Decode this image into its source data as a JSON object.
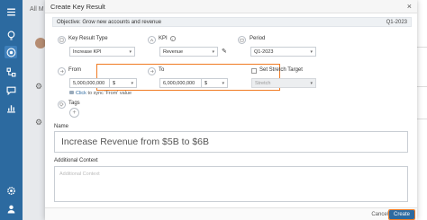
{
  "background": {
    "title": "All M"
  },
  "modal": {
    "title": "Create Key Result",
    "close_symbol": "×"
  },
  "objective": {
    "text": "Objective: Grow new accounts and revenue",
    "period": "Q1-2023"
  },
  "fields": {
    "key_result_type": {
      "label": "Key Result Type",
      "value": "Increase KPI"
    },
    "kpi": {
      "label": "KPI",
      "value": "Revenue"
    },
    "period": {
      "label": "Period",
      "value": "Q1-2023"
    },
    "from": {
      "label": "From",
      "value": "5,000,000,000",
      "unit": "$"
    },
    "to": {
      "label": "To",
      "value": "6,000,000,000",
      "unit": "$"
    },
    "stretch": {
      "label": "Set Stretch Target",
      "value": "Stretch"
    },
    "sync": {
      "link": "Click",
      "text": " to sync 'From' value"
    },
    "tags": {
      "label": "Tags",
      "add": "+"
    },
    "name": {
      "label": "Name",
      "value": "Increase Revenue from $5B to $6B"
    },
    "context": {
      "label": "Additional Context",
      "placeholder": "Additional Context"
    }
  },
  "footer": {
    "cancel": "Cancel",
    "create": "Create"
  },
  "colors": {
    "brand": "#2c6aa0",
    "highlight": "#f07b23"
  }
}
